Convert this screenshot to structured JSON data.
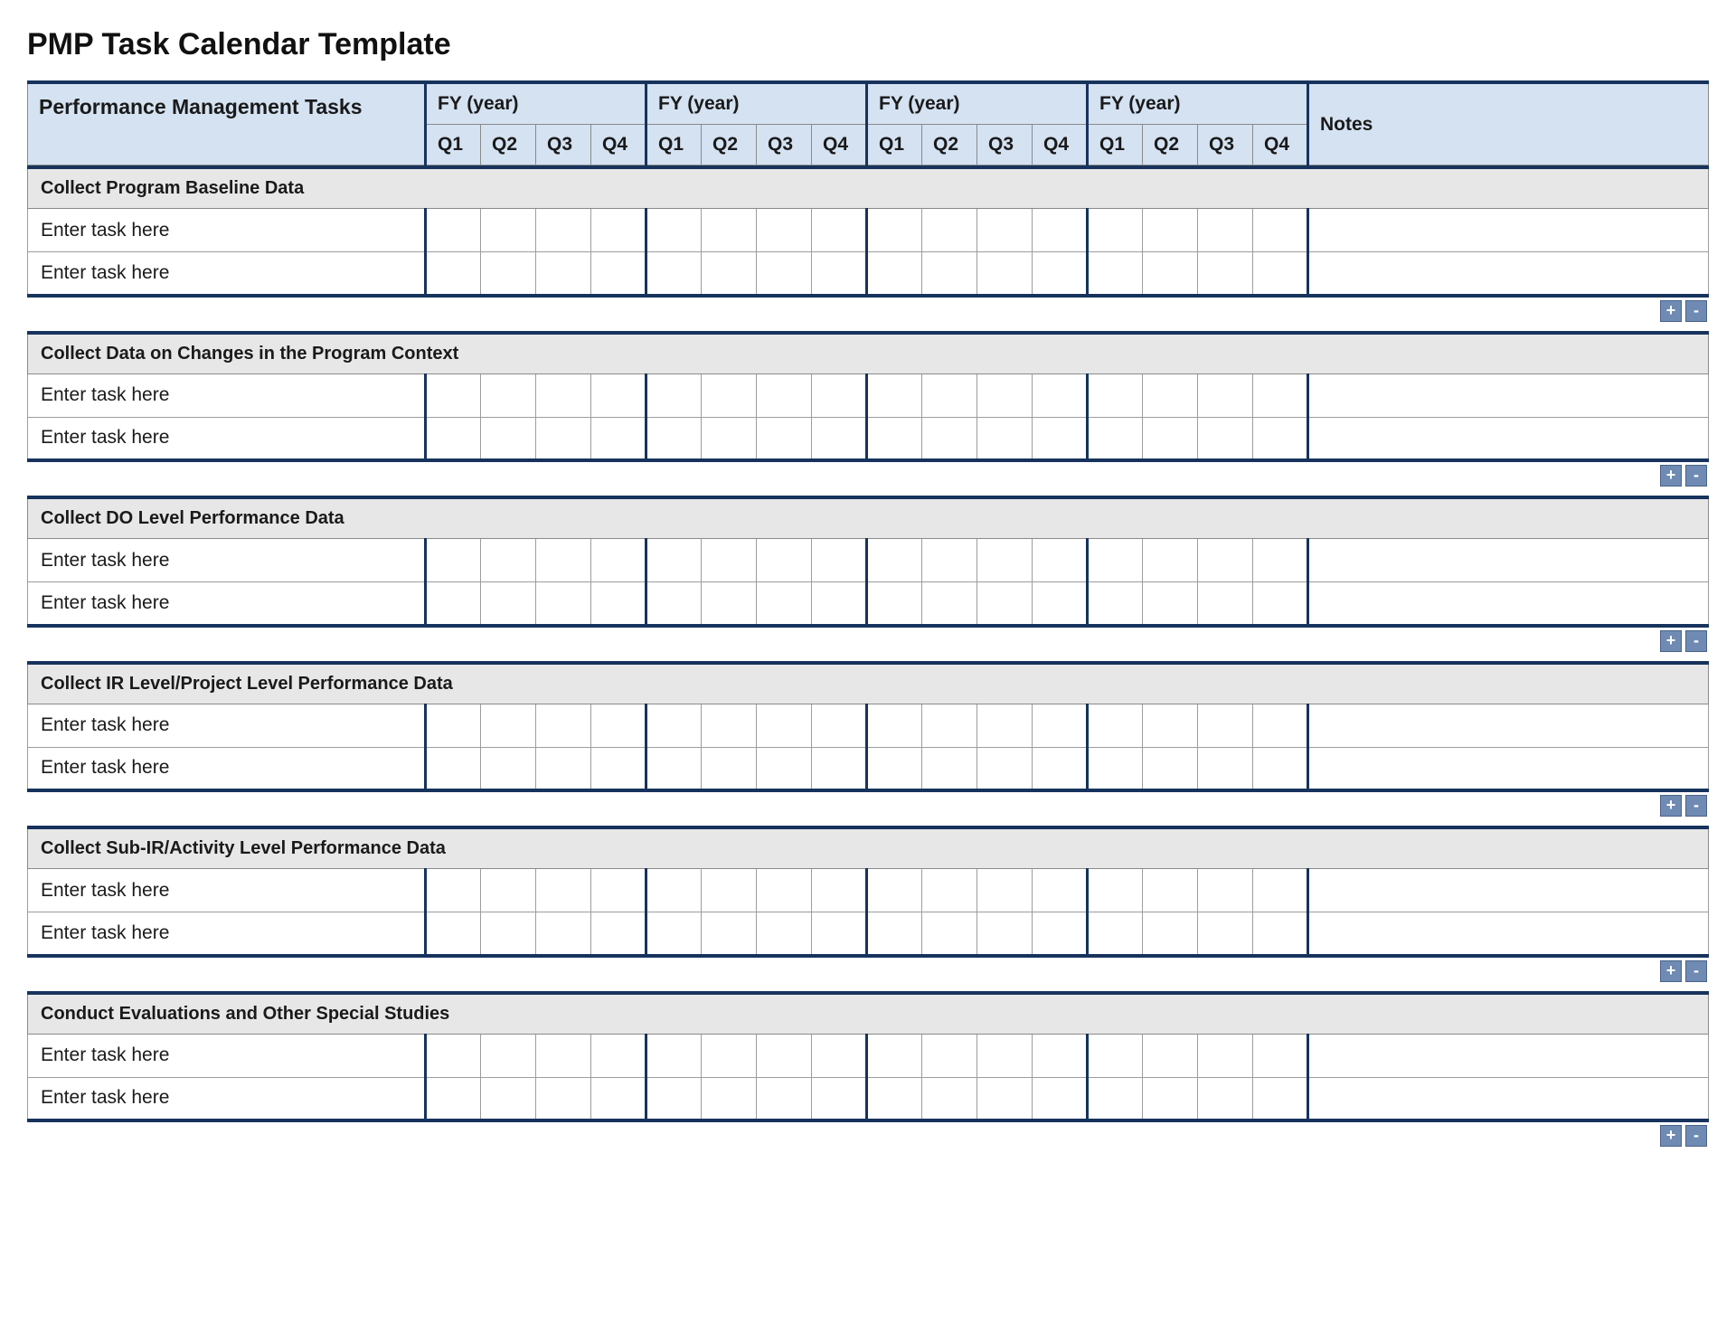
{
  "title": "PMP Task Calendar Template",
  "header": {
    "tasks_label": "Performance Management Tasks",
    "years": [
      {
        "label": "FY  (year)",
        "quarters": [
          "Q1",
          "Q2",
          "Q3",
          "Q4"
        ]
      },
      {
        "label": "FY  (year)",
        "quarters": [
          "Q1",
          "Q2",
          "Q3",
          "Q4"
        ]
      },
      {
        "label": "FY  (year)",
        "quarters": [
          "Q1",
          "Q2",
          "Q3",
          "Q4"
        ]
      },
      {
        "label": "FY  (year)",
        "quarters": [
          "Q1",
          "Q2",
          "Q3",
          "Q4"
        ]
      }
    ],
    "notes_label": "Notes"
  },
  "buttons": {
    "plus": "+",
    "minus": "-"
  },
  "sections": [
    {
      "title": "Collect Program Baseline Data",
      "rows": [
        "Enter task here",
        "Enter task here"
      ]
    },
    {
      "title": "Collect Data on Changes in the Program Context",
      "rows": [
        "Enter task here",
        "Enter task here"
      ]
    },
    {
      "title": "Collect DO Level Performance Data",
      "rows": [
        "Enter task here",
        "Enter task here"
      ]
    },
    {
      "title": "Collect IR Level/Project Level Performance Data",
      "rows": [
        "Enter task here",
        "Enter task here"
      ]
    },
    {
      "title": "Collect Sub-IR/Activity Level Performance Data",
      "rows": [
        "Enter task here",
        "Enter task here"
      ]
    },
    {
      "title": "Conduct Evaluations and Other Special Studies",
      "rows": [
        "Enter task here",
        "Enter task here"
      ]
    }
  ]
}
